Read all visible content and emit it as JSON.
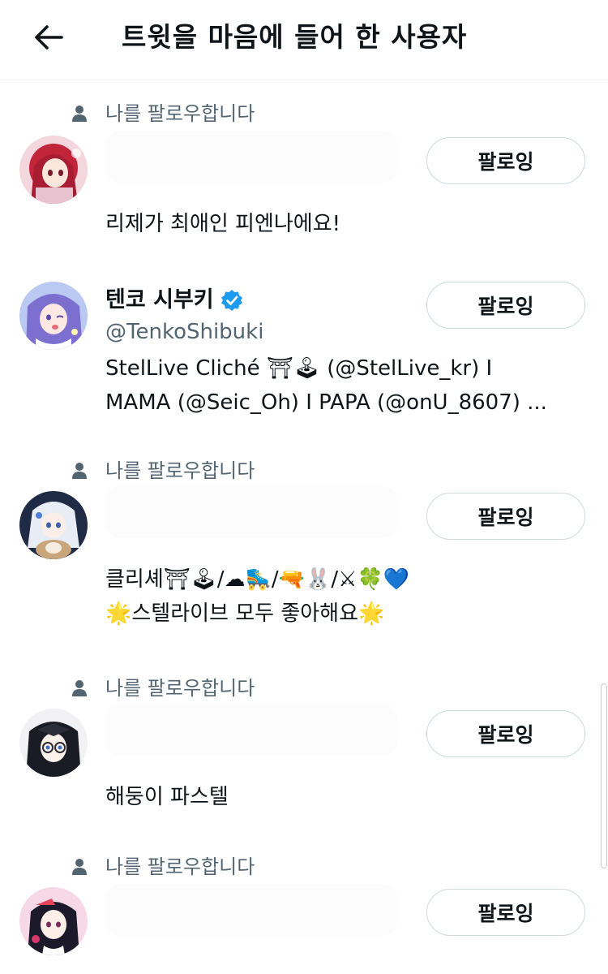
{
  "header": {
    "title": "트윗을 마음에 들어 한 사용자",
    "back_icon": "arrow-left-icon"
  },
  "users": [
    {
      "follows_you": "나를 팔로우합니다",
      "display_name": "",
      "handle": "",
      "bio": "리제가 최애인 피엔나에요!",
      "follow_label": "팔로잉"
    },
    {
      "follows_you": "",
      "display_name": "텐코 시부키",
      "verified": true,
      "handle": "@TenkoShibuki",
      "bio": "StelLive Cliché ⛩🕹 (@StelLive_kr)  I\nMAMA (@Seic_Oh) I PAPA (@onU_8607) ...",
      "follow_label": "팔로잉"
    },
    {
      "follows_you": "나를 팔로우합니다",
      "display_name": "",
      "handle": "",
      "bio": "클리셰⛩🕹/☁🛼/🔫🐰/⚔🍀💙\n🌟스텔라이브 모두 좋아해요🌟",
      "follow_label": "팔로잉"
    },
    {
      "follows_you": "나를 팔로우합니다",
      "display_name": "",
      "handle": "",
      "bio": "해둥이 파스텔",
      "follow_label": "팔로잉"
    },
    {
      "follows_you": "나를 팔로우합니다",
      "display_name": "",
      "handle": "",
      "bio": "",
      "follow_label": "팔로잉"
    }
  ],
  "colors": {
    "text_primary": "#0f1419",
    "text_secondary": "#536471",
    "button_border": "#cfd9de",
    "verified": "#1d9bf0"
  }
}
